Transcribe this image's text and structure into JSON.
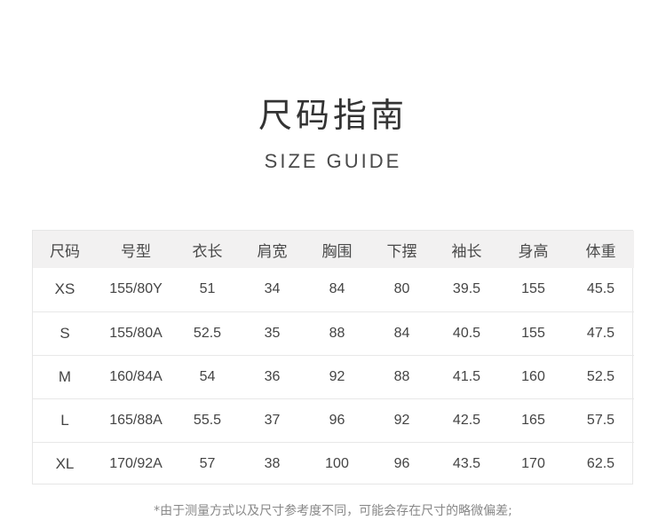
{
  "title_cn": "尺码指南",
  "title_en": "SIZE GUIDE",
  "table": {
    "headers": [
      "尺码",
      "号型",
      "衣长",
      "肩宽",
      "胸围",
      "下摆",
      "袖长",
      "身高",
      "体重"
    ],
    "rows": [
      [
        "XS",
        "155/80Y",
        "51",
        "34",
        "84",
        "80",
        "39.5",
        "155",
        "45.5"
      ],
      [
        "S",
        "155/80A",
        "52.5",
        "35",
        "88",
        "84",
        "40.5",
        "155",
        "47.5"
      ],
      [
        "M",
        "160/84A",
        "54",
        "36",
        "92",
        "88",
        "41.5",
        "160",
        "52.5"
      ],
      [
        "L",
        "165/88A",
        "55.5",
        "37",
        "96",
        "92",
        "42.5",
        "165",
        "57.5"
      ],
      [
        "XL",
        "170/92A",
        "57",
        "38",
        "100",
        "96",
        "43.5",
        "170",
        "62.5"
      ]
    ]
  },
  "note": "*由于测量方式以及尺寸参考度不同，可能会存在尺寸的略微偏差;",
  "colors": {
    "header_bg": "#f2f1f1",
    "border": "#e6e6e6",
    "text": "#3a3a3a"
  }
}
